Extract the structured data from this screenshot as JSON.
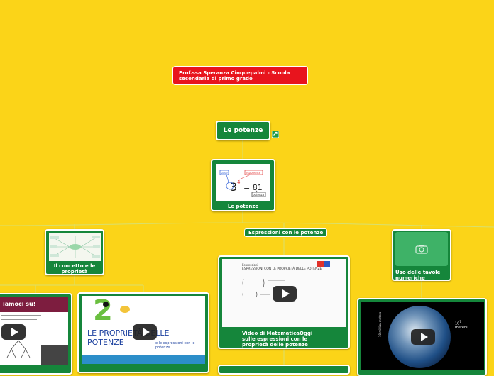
{
  "author_note": "Prof.ssa Speranza Cinquepalmi  - Scuola secondaria di primo grado",
  "root_topic": "Le potenze",
  "root_link_icon": "share-link-icon",
  "main_node": {
    "label": "Le potenze",
    "image_texts": {
      "base_tag": "base",
      "exponent_tag": "esponente",
      "power_tag": "potenza",
      "equation_base": "3",
      "equation_exp": "4",
      "equation_result": "= 81"
    }
  },
  "branches": {
    "concept": {
      "label": "Il concetto e le proprietà"
    },
    "expressions": {
      "label": "Espressioni con le potenze"
    },
    "tables": {
      "label": "Uso delle tavole numeriche",
      "icon": "camera-icon"
    }
  },
  "videos": {
    "left_partial": {
      "banner": "iamoci su!"
    },
    "properties": {
      "image_title": "LE PROPRIETÀ DELLE POTENZE",
      "image_subtitle": "e le espressioni con le potenze",
      "big_digit": "2"
    },
    "matematicaoggi": {
      "screen_head": "Espressioni",
      "screen_title": "ESPRESSIONI CON LE PROPRIETÀ DELLE POTENZE",
      "caption": "Video di MatematicaOggi sulle espressioni con le proprietà delle potenze"
    },
    "earth": {
      "side_text": "10 million meters",
      "exp_base": "10",
      "exp_power": "7",
      "unit": "meters"
    }
  }
}
